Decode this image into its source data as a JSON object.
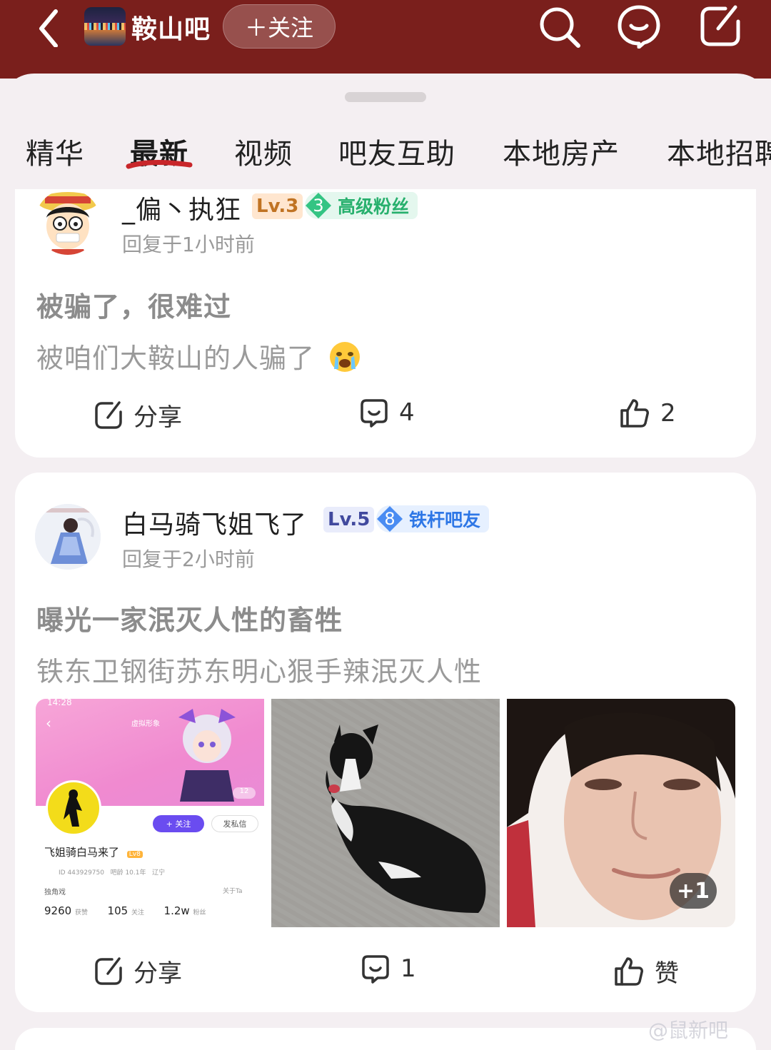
{
  "header": {
    "back_icon": "chevron-left-icon",
    "forum_title": "鞍山吧",
    "follow_label": "＋关注",
    "icons": [
      "search-icon",
      "message-icon",
      "edit-icon"
    ],
    "background": "#7a1f1c"
  },
  "tabs": [
    {
      "label": "精华",
      "active": false
    },
    {
      "label": "最新",
      "active": true
    },
    {
      "label": "视频",
      "active": false
    },
    {
      "label": "吧友互助",
      "active": false
    },
    {
      "label": "本地房产",
      "active": false
    },
    {
      "label": "本地招聘",
      "active": false
    }
  ],
  "posts": [
    {
      "username": "_偏丶执狂",
      "level": "Lv.3",
      "fan_level": "3",
      "fan_title": "高级粉丝",
      "time": "回复于1小时前",
      "title": "被骗了，很难过",
      "body": "被咱们大鞍山的人骗了",
      "emoji": "crying-face-emoji",
      "share_label": "分享",
      "comment_count": "4",
      "like_count": "2"
    },
    {
      "username": "白马骑飞姐飞了",
      "level": "Lv.5",
      "fan_level": "8",
      "fan_title": "铁杆吧友",
      "time": "回复于2小时前",
      "title": "曝光一家泯灭人性的畜牲",
      "body": "铁东卫钢街苏东明心狠手辣泯灭人性",
      "images_extra": "+1",
      "share_label": "分享",
      "comment_count": "1",
      "like_label": "赞",
      "screenshot": {
        "time": "14:28",
        "virtual_label": "虚拟形象",
        "follow": "+ 关注",
        "message": "发私信",
        "name": "飞姐骑白马来了",
        "level_tag": "Lv8",
        "id_line": "ID 443929750",
        "age": "吧龄 10.1年",
        "region": "辽宁",
        "signature": "独角戏",
        "about": "关于Ta",
        "likes": "9260",
        "likes_label": "获赞",
        "follows": "105",
        "follows_label": "关注",
        "fans": "1.2w",
        "fans_label": "粉丝",
        "counter": "12"
      }
    }
  ],
  "watermark": "@鼠新吧"
}
